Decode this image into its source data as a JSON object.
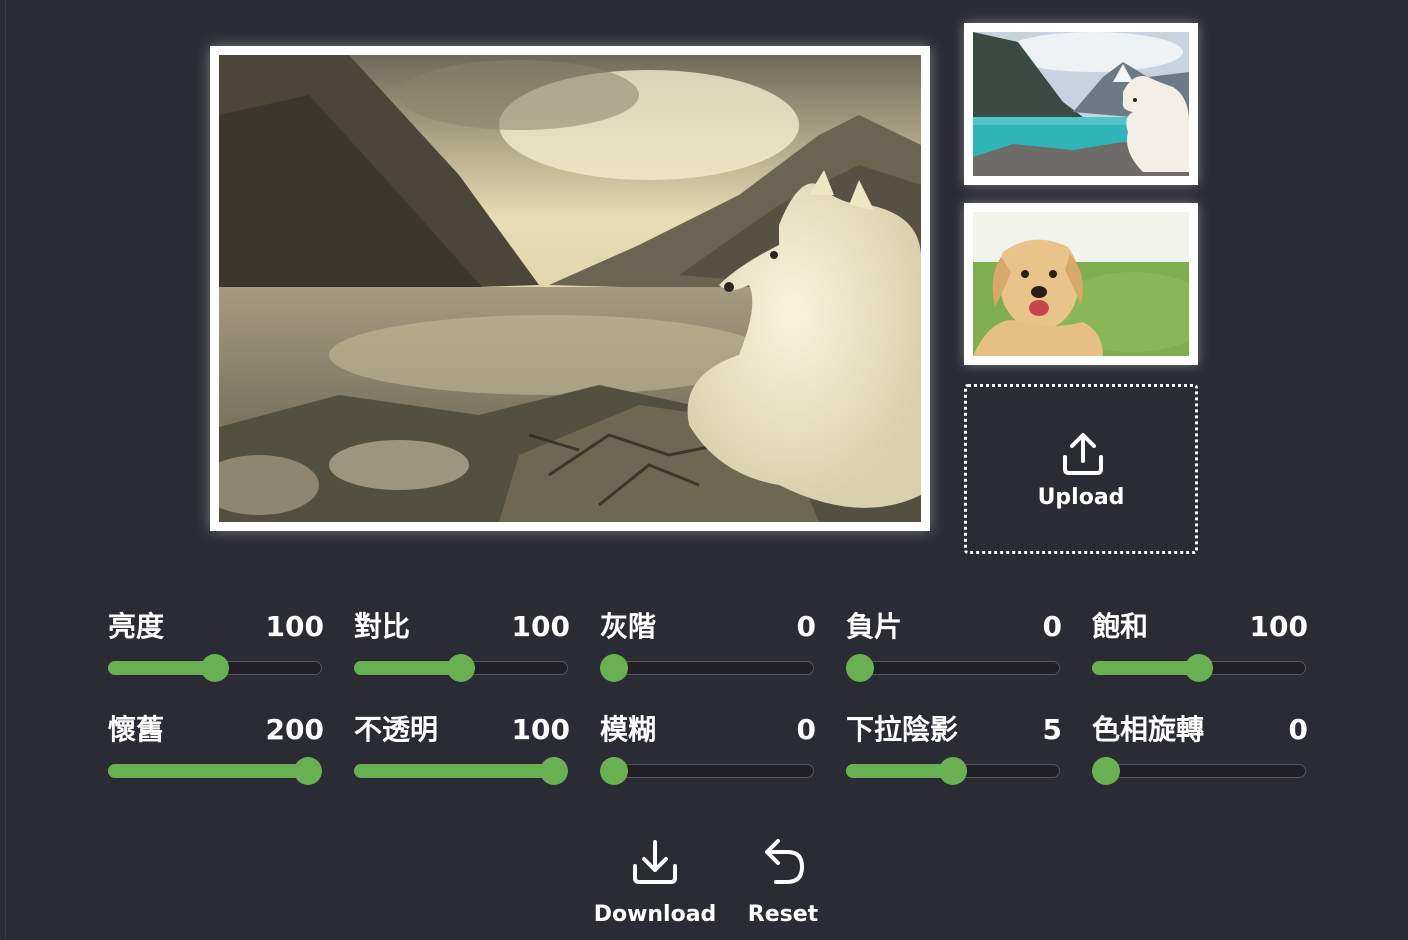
{
  "preview": {
    "filter": "sepia"
  },
  "thumbnails": [
    {
      "subject": "white dog by a turquoise mountain lake"
    },
    {
      "subject": "golden retriever on green grass"
    }
  ],
  "upload": {
    "label": "Upload",
    "icon": "upload-icon"
  },
  "controls": [
    {
      "label": "亮度",
      "value": "100",
      "fraction": 0.5
    },
    {
      "label": "對比",
      "value": "100",
      "fraction": 0.5
    },
    {
      "label": "灰階",
      "value": "0",
      "fraction": 0.0
    },
    {
      "label": "負片",
      "value": "0",
      "fraction": 0.0
    },
    {
      "label": "飽和",
      "value": "100",
      "fraction": 0.5
    },
    {
      "label": "懷舊",
      "value": "200",
      "fraction": 1.0
    },
    {
      "label": "不透明",
      "value": "100",
      "fraction": 1.0
    },
    {
      "label": "模糊",
      "value": "0",
      "fraction": 0.0
    },
    {
      "label": "下拉陰影",
      "value": "5",
      "fraction": 0.5
    },
    {
      "label": "色相旋轉",
      "value": "0",
      "fraction": 0.0
    }
  ],
  "actions": {
    "download_label": "Download",
    "reset_label": "Reset"
  },
  "colors": {
    "background": "#2b2b33",
    "accent": "#68b052",
    "track": "#1f1f25",
    "text": "#ffffff"
  }
}
